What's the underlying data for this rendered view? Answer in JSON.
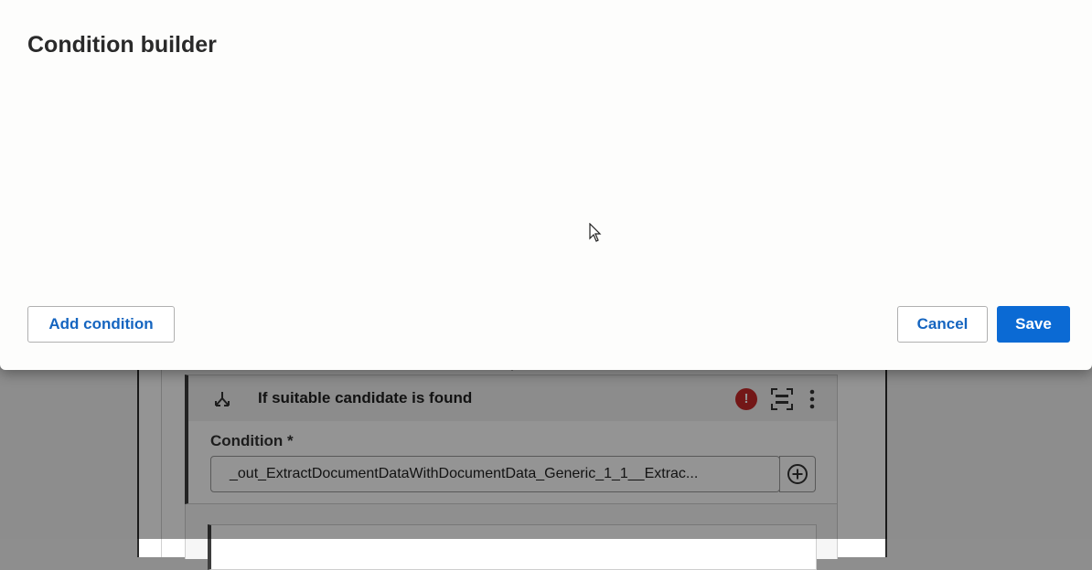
{
  "dialog": {
    "title": "Condition builder",
    "add_condition_label": "Add condition",
    "cancel_label": "Cancel",
    "save_label": "Save"
  },
  "activity": {
    "title": "If suitable candidate is found",
    "condition_label": "Condition *",
    "condition_value": "_out_ExtractDocumentDataWithDocumentData_Generic_1_1__Extrac...",
    "error_icon_glyph": "!",
    "icons": [
      "branch-icon",
      "error-icon",
      "focus-icon",
      "more-vertical-icon",
      "plus-circle-icon"
    ]
  },
  "colors": {
    "accent": "#0b6ad4",
    "link": "#1565c0",
    "error": "#c62828"
  }
}
